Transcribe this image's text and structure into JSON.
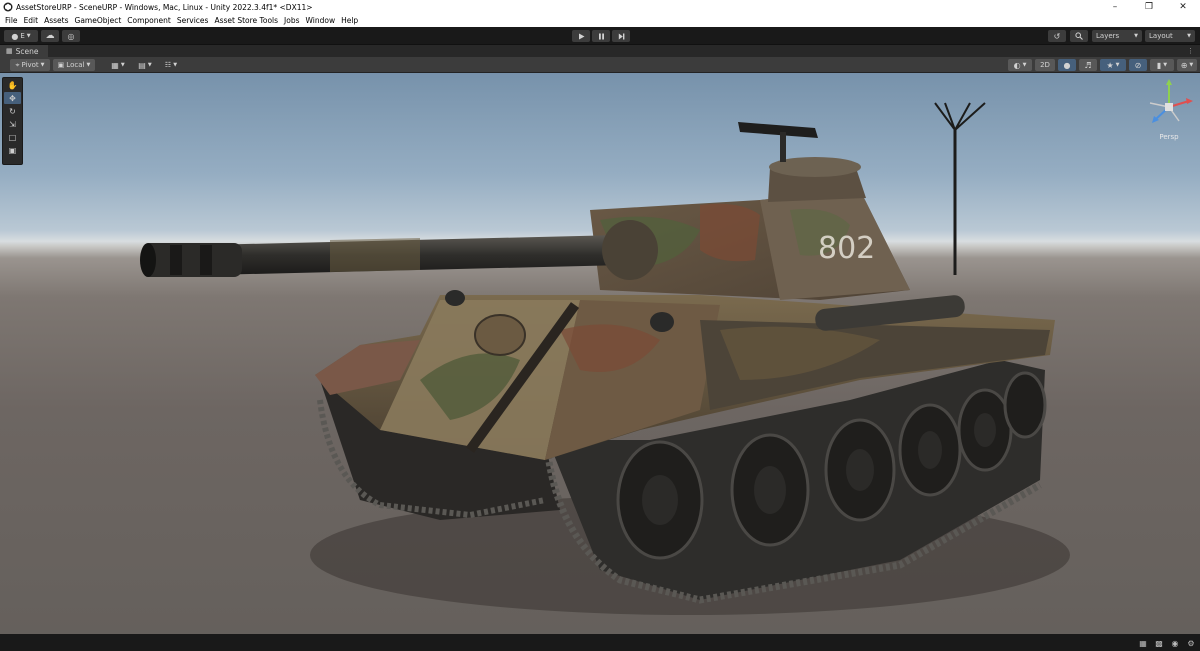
{
  "window": {
    "title": "AssetStoreURP - SceneURP - Windows, Mac, Linux - Unity 2022.3.4f1* <DX11>",
    "controls": [
      "minimize-icon",
      "restore-icon",
      "close-icon"
    ]
  },
  "menu": {
    "items": [
      "File",
      "Edit",
      "Assets",
      "GameObject",
      "Component",
      "Services",
      "Asset Store Tools",
      "Jobs",
      "Window",
      "Help"
    ]
  },
  "toolbar": {
    "account_label": "E",
    "layers_label": "Layers",
    "layout_label": "Layout",
    "play_icon": "play-icon",
    "pause_icon": "pause-icon",
    "step_icon": "step-icon"
  },
  "scene_tab": {
    "label": "Scene"
  },
  "scene_toolbar": {
    "pivot_label": "Pivot",
    "local_label": "Local",
    "mode_2d_label": "2D"
  },
  "tools": [
    "hand-tool-icon",
    "move-tool-icon",
    "rotate-tool-icon",
    "scale-tool-icon",
    "rect-tool-icon",
    "transform-tool-icon"
  ],
  "gizmo": {
    "projection_label": "Persp"
  },
  "scene": {
    "tank_number": "802"
  },
  "colors": {
    "editor_dark": "#191919",
    "panel": "#3c3c3c",
    "active_button": "#46607c",
    "sky_top": "#7792ab",
    "ground": "#6d6662"
  }
}
